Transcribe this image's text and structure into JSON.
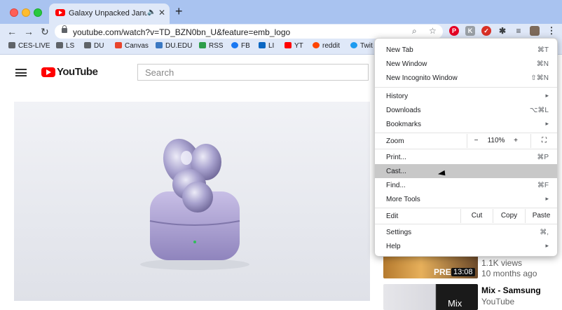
{
  "tab": {
    "title": "Galaxy Unpacked January",
    "audio_icon": "speaker-icon",
    "close": "✕"
  },
  "newtab": "+",
  "toolbar": {
    "back": "←",
    "forward": "→",
    "reload": "↻",
    "url": "youtube.com/watch?v=TD_BZN0bn_U&feature=emb_logo"
  },
  "bookmarks": [
    "CES-LIVE",
    "LS",
    "DU",
    "Canvas",
    "DU.EDU",
    "RSS",
    "FB",
    "LI",
    "YT",
    "reddit",
    "Twit"
  ],
  "youtube": {
    "logo_text": "YouTube",
    "search_placeholder": "Search"
  },
  "recommendations": [
    {
      "views": "1.1K views",
      "age": "10 months ago",
      "badge": "PRE",
      "duration": "13:08"
    },
    {
      "title": "Mix - Samsung",
      "channel": "YouTube",
      "badge": "Mix"
    }
  ],
  "menu": {
    "new_tab": {
      "label": "New Tab",
      "shortcut": "⌘T"
    },
    "new_window": {
      "label": "New Window",
      "shortcut": "⌘N"
    },
    "new_incognito": {
      "label": "New Incognito Window",
      "shortcut": "⇧⌘N"
    },
    "history": "History",
    "downloads": {
      "label": "Downloads",
      "shortcut": "⌥⌘L"
    },
    "bookmarks": "Bookmarks",
    "zoom": {
      "label": "Zoom",
      "minus": "−",
      "value": "110%",
      "plus": "+"
    },
    "print": {
      "label": "Print...",
      "shortcut": "⌘P"
    },
    "cast": "Cast...",
    "find": {
      "label": "Find...",
      "shortcut": "⌘F"
    },
    "more_tools": "More Tools",
    "edit": {
      "label": "Edit",
      "cut": "Cut",
      "copy": "Copy",
      "paste": "Paste"
    },
    "settings": {
      "label": "Settings",
      "shortcut": "⌘,"
    },
    "help": "Help",
    "submenu_arrow": "▸"
  },
  "colors": {
    "tabstrip": "#a9c3f0",
    "toolbar": "#dfe8f8",
    "youtube_red": "#ff0000",
    "highlight": "#c8c8c8"
  }
}
